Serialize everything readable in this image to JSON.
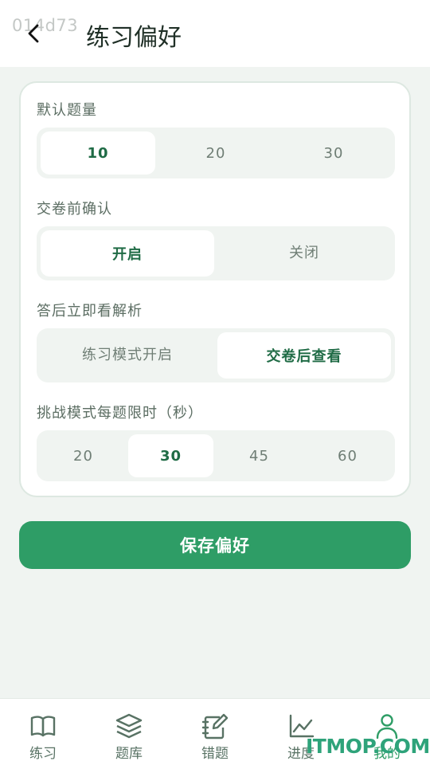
{
  "header": {
    "watermark": "014d73",
    "title": "练习偏好",
    "back_icon": "chevron-left-icon"
  },
  "settings": {
    "default_count": {
      "label": "默认题量",
      "options": [
        "10",
        "20",
        "30"
      ],
      "selected": "10"
    },
    "confirm_submit": {
      "label": "交卷前确认",
      "options": [
        "开启",
        "关闭"
      ],
      "selected": "开启"
    },
    "show_analysis": {
      "label": "答后立即看解析",
      "options": [
        "练习模式开启",
        "交卷后查看"
      ],
      "selected": "交卷后查看"
    },
    "time_limit": {
      "label": "挑战模式每题限时（秒）",
      "options": [
        "20",
        "30",
        "45",
        "60"
      ],
      "selected": "30"
    }
  },
  "save_button": "保存偏好",
  "tabbar": {
    "items": [
      {
        "label": "练习",
        "icon": "book-icon"
      },
      {
        "label": "题库",
        "icon": "layers-icon"
      },
      {
        "label": "错题",
        "icon": "notebook-edit-icon"
      },
      {
        "label": "进度",
        "icon": "line-chart-icon"
      },
      {
        "label": "我的",
        "icon": "user-icon"
      }
    ],
    "active": "我的"
  },
  "site_mark": "ITMOP.COM",
  "colors": {
    "accent": "#2e9d66",
    "active_text": "#1f6b45",
    "background": "#f0f4f1"
  }
}
